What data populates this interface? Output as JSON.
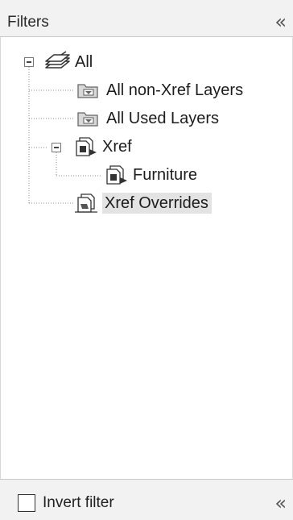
{
  "header": {
    "title": "Filters",
    "collapse_glyph": "«"
  },
  "tree": {
    "root": {
      "label": "All",
      "icon": "layers-stack-icon",
      "expanded": true
    },
    "children": [
      {
        "label": "All non-Xref Layers",
        "icon": "filter-folder-icon"
      },
      {
        "label": "All Used Layers",
        "icon": "filter-folder-icon"
      },
      {
        "label": "Xref",
        "icon": "xref-icon",
        "expanded": true,
        "children": [
          {
            "label": "Furniture",
            "icon": "xref-icon"
          }
        ]
      },
      {
        "label": "Xref Overrides",
        "icon": "xref-overrides-icon",
        "selected": true
      }
    ]
  },
  "footer": {
    "invert_label": "Invert filter",
    "invert_checked": false,
    "collapse_glyph": "«"
  }
}
